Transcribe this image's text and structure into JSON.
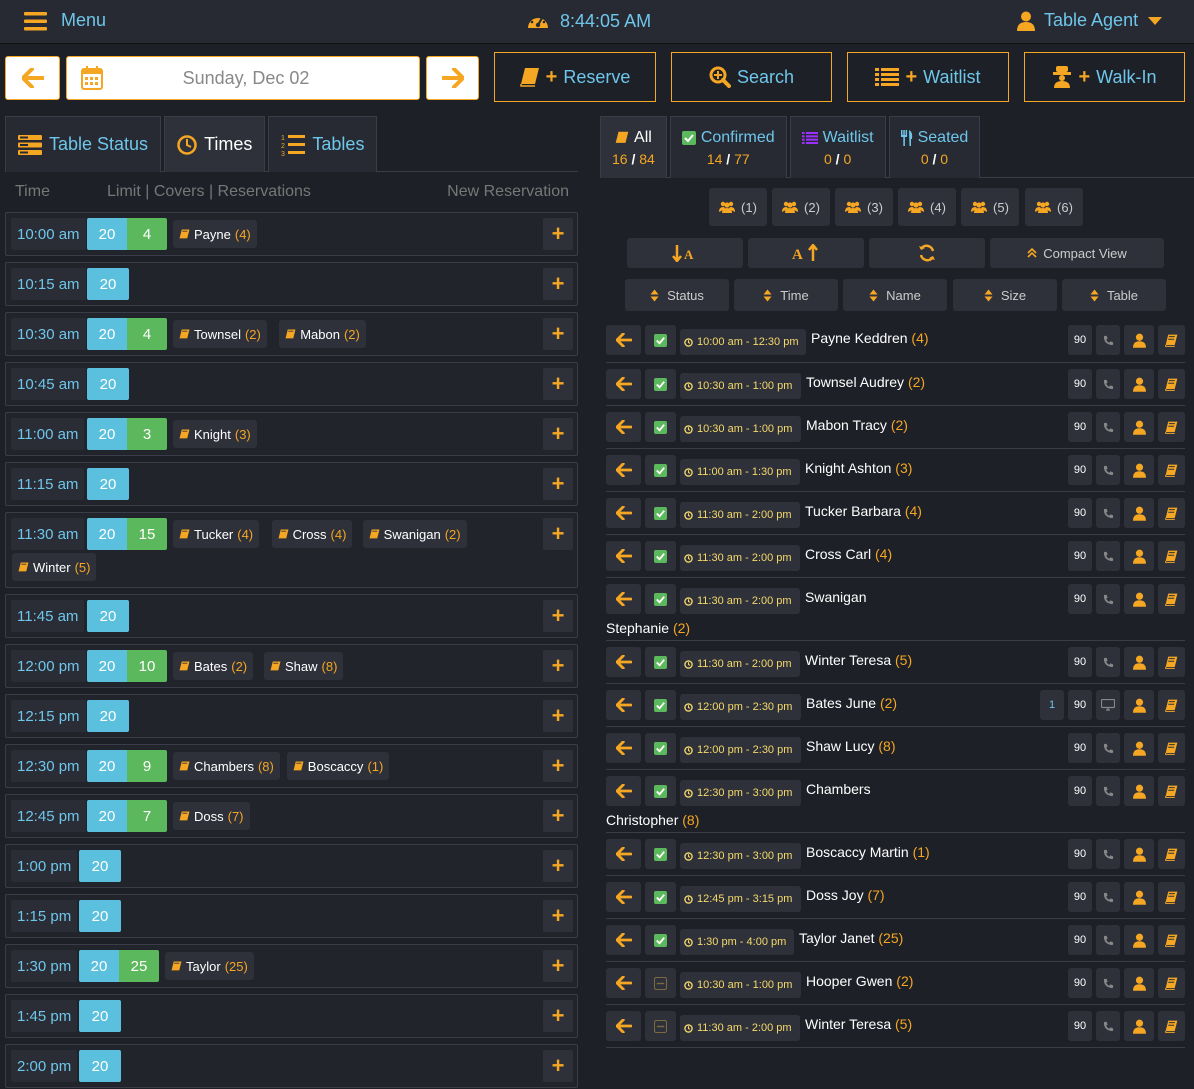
{
  "topbar": {
    "menu_label": "Menu",
    "clock": "8:44:05 AM",
    "agent": "Table Agent"
  },
  "nav": {
    "date": "Sunday, Dec 02",
    "reserve": "Reserve",
    "search": "Search",
    "waitlist": "Waitlist",
    "walkin": "Walk-In"
  },
  "left_tabs": [
    "Table Status",
    "Times",
    "Tables"
  ],
  "left_header": {
    "time": "Time",
    "limit": "Limit | Covers | Reservations",
    "new": "New Reservation"
  },
  "slots": [
    {
      "time": "10:00 am",
      "limit": "20",
      "covers": "4",
      "res": [
        {
          "name": "Payne",
          "n": "(4)"
        }
      ]
    },
    {
      "time": "10:15 am",
      "limit": "20",
      "covers": "",
      "res": []
    },
    {
      "time": "10:30 am",
      "limit": "20",
      "covers": "4",
      "res": [
        {
          "name": "Townsel",
          "n": "(2)"
        },
        {
          "name": "Mabon",
          "n": "(2)"
        }
      ]
    },
    {
      "time": "10:45 am",
      "limit": "20",
      "covers": "",
      "res": []
    },
    {
      "time": "11:00 am",
      "limit": "20",
      "covers": "3",
      "res": [
        {
          "name": "Knight",
          "n": "(3)"
        }
      ]
    },
    {
      "time": "11:15 am",
      "limit": "20",
      "covers": "",
      "res": []
    },
    {
      "time": "11:30 am",
      "limit": "20",
      "covers": "15",
      "res": [
        {
          "name": "Tucker",
          "n": "(4)"
        },
        {
          "name": "Cross",
          "n": "(4)"
        },
        {
          "name": "Swanigan",
          "n": "(2)"
        },
        {
          "name": "Winter",
          "n": "(5)"
        }
      ]
    },
    {
      "time": "11:45 am",
      "limit": "20",
      "covers": "",
      "res": []
    },
    {
      "time": "12:00 pm",
      "limit": "20",
      "covers": "10",
      "res": [
        {
          "name": "Bates",
          "n": "(2)"
        },
        {
          "name": "Shaw",
          "n": "(8)"
        }
      ]
    },
    {
      "time": "12:15 pm",
      "limit": "20",
      "covers": "",
      "res": []
    },
    {
      "time": "12:30 pm",
      "limit": "20",
      "covers": "9",
      "res": [
        {
          "name": "Chambers",
          "n": "(8)"
        },
        {
          "name": "Boscaccy",
          "n": "(1)"
        }
      ]
    },
    {
      "time": "12:45 pm",
      "limit": "20",
      "covers": "7",
      "res": [
        {
          "name": "Doss",
          "n": "(7)"
        }
      ]
    },
    {
      "time": "1:00 pm",
      "limit": "20",
      "covers": "",
      "res": []
    },
    {
      "time": "1:15 pm",
      "limit": "20",
      "covers": "",
      "res": []
    },
    {
      "time": "1:30 pm",
      "limit": "20",
      "covers": "25",
      "res": [
        {
          "name": "Taylor",
          "n": "(25)"
        }
      ]
    },
    {
      "time": "1:45 pm",
      "limit": "20",
      "covers": "",
      "res": []
    },
    {
      "time": "2:00 pm",
      "limit": "20",
      "covers": "",
      "res": []
    }
  ],
  "right_tabs": [
    {
      "label": "All",
      "a": "16",
      "b": "84"
    },
    {
      "label": "Confirmed",
      "a": "14",
      "b": "77"
    },
    {
      "label": "Waitlist",
      "a": "0",
      "b": "0"
    },
    {
      "label": "Seated",
      "a": "0",
      "b": "0"
    }
  ],
  "sizes": [
    "(1)",
    "(2)",
    "(3)",
    "(4)",
    "(5)",
    "(6)"
  ],
  "compact_view": "Compact View",
  "filters": [
    "Status",
    "Time",
    "Name",
    "Size",
    "Table"
  ],
  "reservations": [
    {
      "time": "10:00 am - 12:30 pm",
      "name": "Payne Keddren",
      "name2": "",
      "n": "(4)",
      "dur": "90",
      "table": "",
      "status": "confirmed"
    },
    {
      "time": "10:30 am - 1:00 pm",
      "name": "Townsel Audrey",
      "name2": "",
      "n": "(2)",
      "dur": "90",
      "table": "",
      "status": "confirmed"
    },
    {
      "time": "10:30 am - 1:00 pm",
      "name": "Mabon Tracy",
      "name2": "",
      "n": "(2)",
      "dur": "90",
      "table": "",
      "status": "confirmed"
    },
    {
      "time": "11:00 am - 1:30 pm",
      "name": "Knight Ashton",
      "name2": "",
      "n": "(3)",
      "dur": "90",
      "table": "",
      "status": "confirmed"
    },
    {
      "time": "11:30 am - 2:00 pm",
      "name": "Tucker Barbara",
      "name2": "",
      "n": "(4)",
      "dur": "90",
      "table": "",
      "status": "confirmed"
    },
    {
      "time": "11:30 am - 2:00 pm",
      "name": "Cross Carl",
      "name2": "",
      "n": "(4)",
      "dur": "90",
      "table": "",
      "status": "confirmed"
    },
    {
      "time": "11:30 am - 2:00 pm",
      "name": "Swanigan",
      "name2": "Stephanie",
      "n": "(2)",
      "dur": "90",
      "table": "",
      "status": "confirmed"
    },
    {
      "time": "11:30 am - 2:00 pm",
      "name": "Winter Teresa",
      "name2": "",
      "n": "(5)",
      "dur": "90",
      "table": "",
      "status": "confirmed"
    },
    {
      "time": "12:00 pm - 2:30 pm",
      "name": "Bates June",
      "name2": "",
      "n": "(2)",
      "dur": "90",
      "table": "1",
      "status": "confirmed"
    },
    {
      "time": "12:00 pm - 2:30 pm",
      "name": "Shaw Lucy",
      "name2": "",
      "n": "(8)",
      "dur": "90",
      "table": "",
      "status": "confirmed"
    },
    {
      "time": "12:30 pm - 3:00 pm",
      "name": "Chambers",
      "name2": "Christopher",
      "n": "(8)",
      "dur": "90",
      "table": "",
      "status": "confirmed"
    },
    {
      "time": "12:30 pm - 3:00 pm",
      "name": "Boscaccy Martin",
      "name2": "",
      "n": "(1)",
      "dur": "90",
      "table": "",
      "status": "confirmed"
    },
    {
      "time": "12:45 pm - 3:15 pm",
      "name": "Doss Joy",
      "name2": "",
      "n": "(7)",
      "dur": "90",
      "table": "",
      "status": "confirmed"
    },
    {
      "time": "1:30 pm - 4:00 pm",
      "name": "Taylor Janet",
      "name2": "",
      "n": "(25)",
      "dur": "90",
      "table": "",
      "status": "confirmed"
    },
    {
      "time": "10:30 am - 1:00 pm",
      "name": "Hooper Gwen",
      "name2": "",
      "n": "(2)",
      "dur": "90",
      "table": "",
      "status": "pending"
    },
    {
      "time": "11:30 am - 2:00 pm",
      "name": "Winter Teresa",
      "name2": "",
      "n": "(5)",
      "dur": "90",
      "table": "",
      "status": "pending"
    }
  ],
  "colors": {
    "accent": "#f5a623",
    "link": "#6ec6ea",
    "limit": "#5bc0de",
    "covers": "#5cb85c",
    "waitlist": "#9b30ff"
  }
}
